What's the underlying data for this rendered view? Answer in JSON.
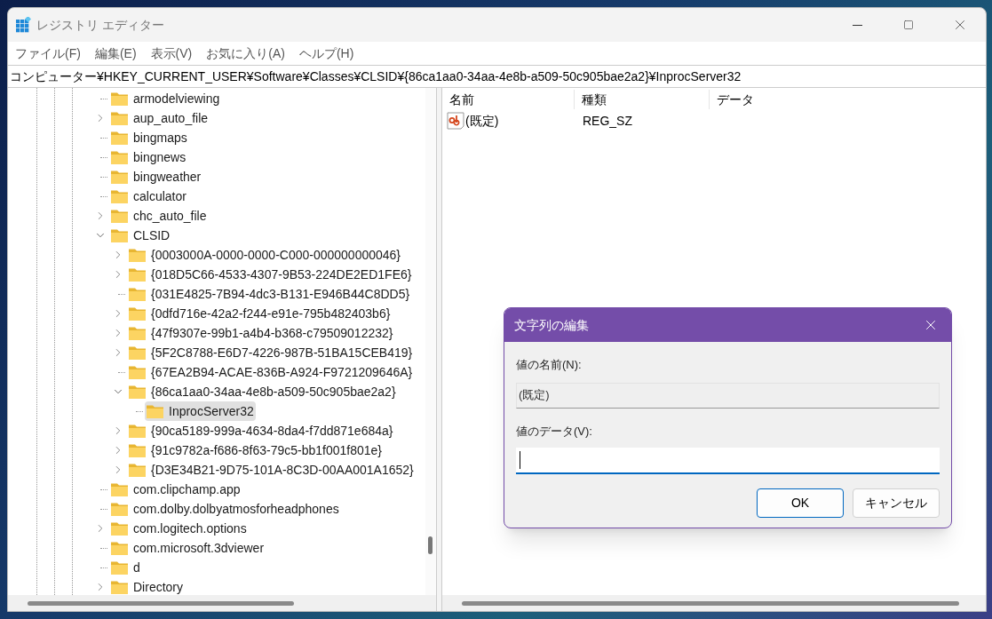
{
  "window": {
    "title": "レジストリ エディター"
  },
  "menu": [
    "ファイル(F)",
    "編集(E)",
    "表示(V)",
    "お気に入り(A)",
    "ヘルプ(H)"
  ],
  "address": "コンピューター¥HKEY_CURRENT_USER¥Software¥Classes¥CLSID¥{86ca1aa0-34aa-4e8b-a509-50c905bae2a2}¥InprocServer32",
  "tree": [
    {
      "label": "armodelviewing",
      "expandable": false,
      "selected": false
    },
    {
      "label": "aup_auto_file",
      "expandable": true,
      "expanded": false,
      "selected": false
    },
    {
      "label": "bingmaps",
      "expandable": false,
      "selected": false
    },
    {
      "label": "bingnews",
      "expandable": false,
      "selected": false
    },
    {
      "label": "bingweather",
      "expandable": false,
      "selected": false
    },
    {
      "label": "calculator",
      "expandable": false,
      "selected": false
    },
    {
      "label": "chc_auto_file",
      "expandable": true,
      "expanded": false,
      "selected": false
    },
    {
      "label": "CLSID",
      "expandable": true,
      "expanded": true,
      "selected": false,
      "children": [
        {
          "label": "{0003000A-0000-0000-C000-000000000046}",
          "expandable": true,
          "expanded": false,
          "selected": false
        },
        {
          "label": "{018D5C66-4533-4307-9B53-224DE2ED1FE6}",
          "expandable": true,
          "expanded": false,
          "selected": false
        },
        {
          "label": "{031E4825-7B94-4dc3-B131-E946B44C8DD5}",
          "expandable": false,
          "selected": false
        },
        {
          "label": "{0dfd716e-42a2-f244-e91e-795b482403b6}",
          "expandable": true,
          "expanded": false,
          "selected": false
        },
        {
          "label": "{47f9307e-99b1-a4b4-b368-c79509012232}",
          "expandable": true,
          "expanded": false,
          "selected": false
        },
        {
          "label": "{5F2C8788-E6D7-4226-987B-51BA15CEB419}",
          "expandable": true,
          "expanded": false,
          "selected": false
        },
        {
          "label": "{67EA2B94-ACAE-836B-A924-F9721209646A}",
          "expandable": false,
          "selected": false
        },
        {
          "label": "{86ca1aa0-34aa-4e8b-a509-50c905bae2a2}",
          "expandable": true,
          "expanded": true,
          "selected": false,
          "children": [
            {
              "label": "InprocServer32",
              "expandable": false,
              "selected": true
            }
          ]
        },
        {
          "label": "{90ca5189-999a-4634-8da4-f7dd871e684a}",
          "expandable": true,
          "expanded": false,
          "selected": false
        },
        {
          "label": "{91c9782a-f686-8f63-79c5-bb1f001f801e}",
          "expandable": true,
          "expanded": false,
          "selected": false
        },
        {
          "label": "{D3E34B21-9D75-101A-8C3D-00AA001A1652}",
          "expandable": true,
          "expanded": false,
          "selected": false
        }
      ]
    },
    {
      "label": "com.clipchamp.app",
      "expandable": false,
      "selected": false
    },
    {
      "label": "com.dolby.dolbyatmosforheadphones",
      "expandable": false,
      "selected": false
    },
    {
      "label": "com.logitech.options",
      "expandable": true,
      "expanded": false,
      "selected": false
    },
    {
      "label": "com.microsoft.3dviewer",
      "expandable": false,
      "selected": false
    },
    {
      "label": "d",
      "expandable": false,
      "selected": false
    },
    {
      "label": "Directory",
      "expandable": true,
      "expanded": false,
      "selected": false
    }
  ],
  "values": {
    "columns": [
      "名前",
      "種類",
      "データ"
    ],
    "rows": [
      {
        "name": "(既定)",
        "type": "REG_SZ"
      }
    ]
  },
  "dialog": {
    "title": "文字列の編集",
    "name_label": "値の名前(N):",
    "name_value": "(既定)",
    "data_label": "値のデータ(V):",
    "buttons": [
      {
        "label": "OK",
        "default": true
      },
      {
        "label": "キャンセル",
        "default": false
      }
    ]
  }
}
